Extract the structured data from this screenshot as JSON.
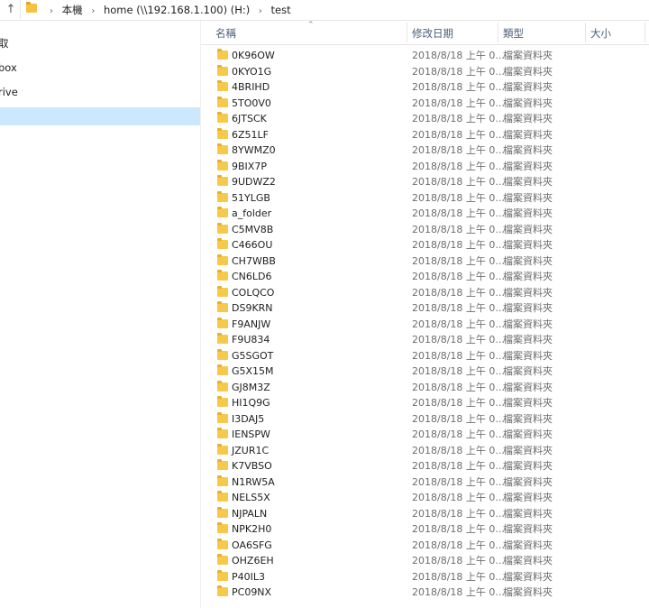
{
  "address_bar": {
    "crumbs": [
      "本機",
      "home (\\\\192.168.1.100) (H:)",
      "test"
    ]
  },
  "nav_pane": {
    "items": [
      "取",
      "box",
      "rive"
    ]
  },
  "columns": {
    "name": "名稱",
    "date": "修改日期",
    "type": "類型",
    "size": "大小"
  },
  "files": [
    {
      "name": "0K96OW",
      "date": "2018/8/18 上午 0...",
      "type": "檔案資料夾"
    },
    {
      "name": "0KYO1G",
      "date": "2018/8/18 上午 0...",
      "type": "檔案資料夾"
    },
    {
      "name": "4BRIHD",
      "date": "2018/8/18 上午 0...",
      "type": "檔案資料夾"
    },
    {
      "name": "5TO0V0",
      "date": "2018/8/18 上午 0...",
      "type": "檔案資料夾"
    },
    {
      "name": "6JTSCK",
      "date": "2018/8/18 上午 0...",
      "type": "檔案資料夾"
    },
    {
      "name": "6Z51LF",
      "date": "2018/8/18 上午 0...",
      "type": "檔案資料夾"
    },
    {
      "name": "8YWMZ0",
      "date": "2018/8/18 上午 0...",
      "type": "檔案資料夾"
    },
    {
      "name": "9BIX7P",
      "date": "2018/8/18 上午 0...",
      "type": "檔案資料夾"
    },
    {
      "name": "9UDWZ2",
      "date": "2018/8/18 上午 0...",
      "type": "檔案資料夾"
    },
    {
      "name": "51YLGB",
      "date": "2018/8/18 上午 0...",
      "type": "檔案資料夾"
    },
    {
      "name": "a_folder",
      "date": "2018/8/18 上午 0...",
      "type": "檔案資料夾"
    },
    {
      "name": "C5MV8B",
      "date": "2018/8/18 上午 0...",
      "type": "檔案資料夾"
    },
    {
      "name": "C466OU",
      "date": "2018/8/18 上午 0...",
      "type": "檔案資料夾"
    },
    {
      "name": "CH7WBB",
      "date": "2018/8/18 上午 0...",
      "type": "檔案資料夾"
    },
    {
      "name": "CN6LD6",
      "date": "2018/8/18 上午 0...",
      "type": "檔案資料夾"
    },
    {
      "name": "COLQCO",
      "date": "2018/8/18 上午 0...",
      "type": "檔案資料夾"
    },
    {
      "name": "DS9KRN",
      "date": "2018/8/18 上午 0...",
      "type": "檔案資料夾"
    },
    {
      "name": "F9ANJW",
      "date": "2018/8/18 上午 0...",
      "type": "檔案資料夾"
    },
    {
      "name": "F9U834",
      "date": "2018/8/18 上午 0...",
      "type": "檔案資料夾"
    },
    {
      "name": "G5SGOT",
      "date": "2018/8/18 上午 0...",
      "type": "檔案資料夾"
    },
    {
      "name": "G5X15M",
      "date": "2018/8/18 上午 0...",
      "type": "檔案資料夾"
    },
    {
      "name": "GJ8M3Z",
      "date": "2018/8/18 上午 0...",
      "type": "檔案資料夾"
    },
    {
      "name": "HI1Q9G",
      "date": "2018/8/18 上午 0...",
      "type": "檔案資料夾"
    },
    {
      "name": "I3DAJ5",
      "date": "2018/8/18 上午 0...",
      "type": "檔案資料夾"
    },
    {
      "name": "IENSPW",
      "date": "2018/8/18 上午 0...",
      "type": "檔案資料夾"
    },
    {
      "name": "JZUR1C",
      "date": "2018/8/18 上午 0...",
      "type": "檔案資料夾"
    },
    {
      "name": "K7VBSO",
      "date": "2018/8/18 上午 0...",
      "type": "檔案資料夾"
    },
    {
      "name": "N1RW5A",
      "date": "2018/8/18 上午 0...",
      "type": "檔案資料夾"
    },
    {
      "name": "NELS5X",
      "date": "2018/8/18 上午 0...",
      "type": "檔案資料夾"
    },
    {
      "name": "NJPALN",
      "date": "2018/8/18 上午 0...",
      "type": "檔案資料夾"
    },
    {
      "name": "NPK2H0",
      "date": "2018/8/18 上午 0...",
      "type": "檔案資料夾"
    },
    {
      "name": "OA6SFG",
      "date": "2018/8/18 上午 0...",
      "type": "檔案資料夾"
    },
    {
      "name": "OHZ6EH",
      "date": "2018/8/18 上午 0...",
      "type": "檔案資料夾"
    },
    {
      "name": "P40IL3",
      "date": "2018/8/18 上午 0...",
      "type": "檔案資料夾"
    },
    {
      "name": "PC09NX",
      "date": "2018/8/18 上午 0...",
      "type": "檔案資料夾"
    }
  ],
  "icons": {
    "up": "arrow-up-icon",
    "folder": "folder-icon",
    "sort": "sort-ascending-icon"
  },
  "colors": {
    "selection": "#cce8ff",
    "header_text": "#4c607a",
    "folder": "#f7c94a"
  }
}
